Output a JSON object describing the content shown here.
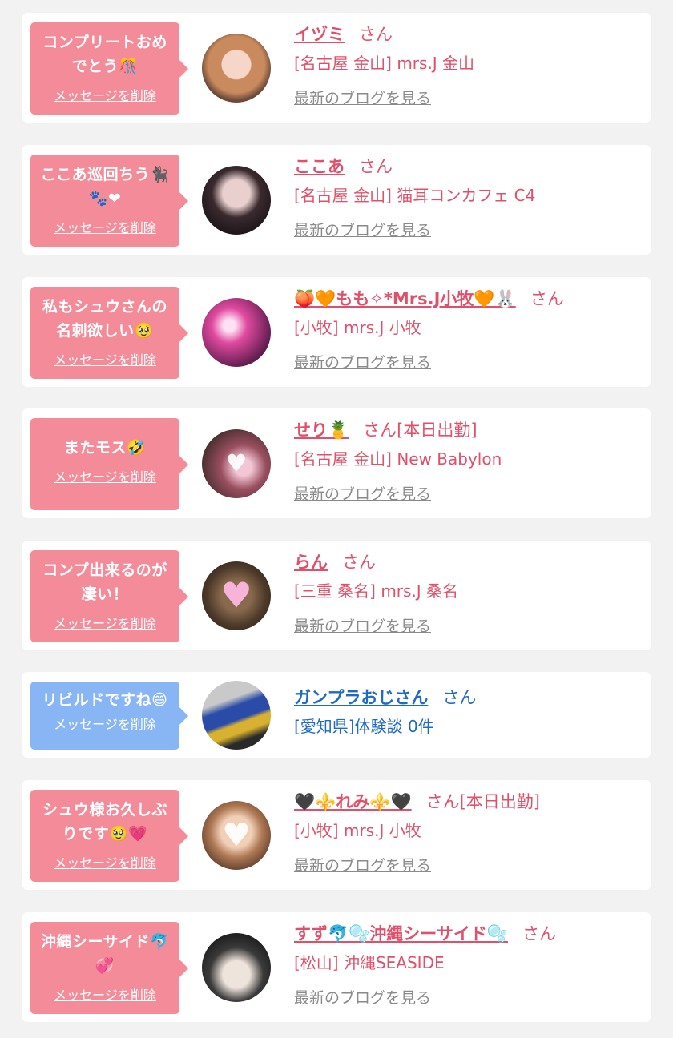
{
  "items": [
    {
      "message": "コンプリートおめでとう🎊",
      "delete_label": "メッセージを削除",
      "name": "イヅミ",
      "san": "さん",
      "shop": "[名古屋 金山] mrs.J 金山",
      "blog_label": "最新のブログを見る"
    },
    {
      "message": "ここあ巡回ちう🐈‍⬛🐾❤",
      "delete_label": "メッセージを削除",
      "name": "ここあ",
      "san": "さん",
      "shop": "[名古屋 金山] 猫耳コンカフェ C4",
      "blog_label": "最新のブログを見る"
    },
    {
      "message": "私もシュウさんの名刺欲しい🥹",
      "delete_label": "メッセージを削除",
      "name": "🍑🧡もも✧*Mrs.J小牧🧡🐰",
      "san": "さん",
      "shop": "[小牧] mrs.J 小牧",
      "blog_label": "最新のブログを見る"
    },
    {
      "message": "またモス🤣",
      "delete_label": "メッセージを削除",
      "name": "せり🍍",
      "san": "さん[本日出勤]",
      "shop": "[名古屋 金山] New Babylon",
      "blog_label": "最新のブログを見る"
    },
    {
      "message": "コンプ出来るのが凄い！",
      "delete_label": "メッセージを削除",
      "name": "らん",
      "san": "さん",
      "shop": "[三重 桑名] mrs.J 桑名",
      "blog_label": "最新のブログを見る"
    },
    {
      "message": "リビルドですね😄",
      "delete_label": "メッセージを削除",
      "name": "ガンプラおじさん",
      "san": "さん",
      "shop": "[愛知県]体験談 0件"
    },
    {
      "message": "シュウ様お久しぶりです🥹💗",
      "delete_label": "メッセージを削除",
      "name": "🖤⚜️れみ⚜️🖤",
      "san": "さん[本日出勤]",
      "shop": "[小牧] mrs.J 小牧",
      "blog_label": "最新のブログを見る"
    },
    {
      "message": "沖縄シーサイド🐬💞",
      "delete_label": "メッセージを削除",
      "name": "すず🐬🫧沖縄シーサイド🫧",
      "san": "さん",
      "shop": "[松山] 沖縄SEASIDE",
      "blog_label": "最新のブログを見る"
    }
  ],
  "colors": {
    "cast_accent": "#e0506a",
    "user_accent": "#1e6bbf",
    "cast_bubble": "#f48b99",
    "user_bubble": "#88b6f5",
    "page_bg": "#f2f2f2"
  }
}
